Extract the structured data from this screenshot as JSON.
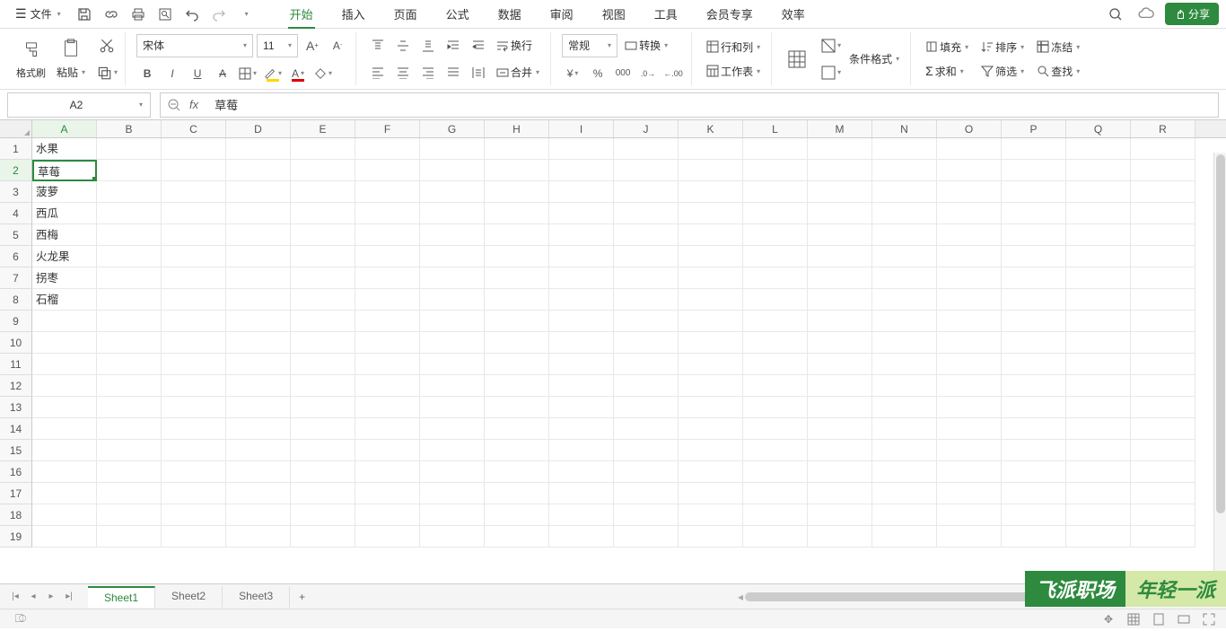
{
  "menu": {
    "file": "文件",
    "tabs": [
      "开始",
      "插入",
      "页面",
      "公式",
      "数据",
      "审阅",
      "视图",
      "工具",
      "会员专享",
      "效率"
    ],
    "activeTab": 0,
    "share": "分享"
  },
  "ribbon": {
    "formatPainter": "格式刷",
    "paste": "粘贴",
    "fontName": "宋体",
    "fontSize": "11",
    "wrap": "换行",
    "numberFormat": "常规",
    "convert": "转换",
    "rowsCols": "行和列",
    "worksheet": "工作表",
    "condFormat": "条件格式",
    "fill": "填充",
    "sort": "排序",
    "freeze": "冻结",
    "sum": "求和",
    "filter": "筛选",
    "find": "查找",
    "merge": "合并"
  },
  "nameBox": "A2",
  "formulaBar": "草莓",
  "columns": [
    "A",
    "B",
    "C",
    "D",
    "E",
    "F",
    "G",
    "H",
    "I",
    "J",
    "K",
    "L",
    "M",
    "N",
    "O",
    "P",
    "Q",
    "R"
  ],
  "rowCount": 19,
  "activeCell": {
    "row": 2,
    "col": 0
  },
  "cellData": {
    "A1": "水果",
    "A2": "草莓",
    "A3": "菠萝",
    "A4": "西瓜",
    "A5": "西梅",
    "A6": "火龙果",
    "A7": "拐枣",
    "A8": "石榴"
  },
  "sheets": [
    "Sheet1",
    "Sheet2",
    "Sheet3"
  ],
  "activeSheet": 0,
  "watermark": {
    "left": "飞派职场",
    "right": "年轻一派"
  }
}
